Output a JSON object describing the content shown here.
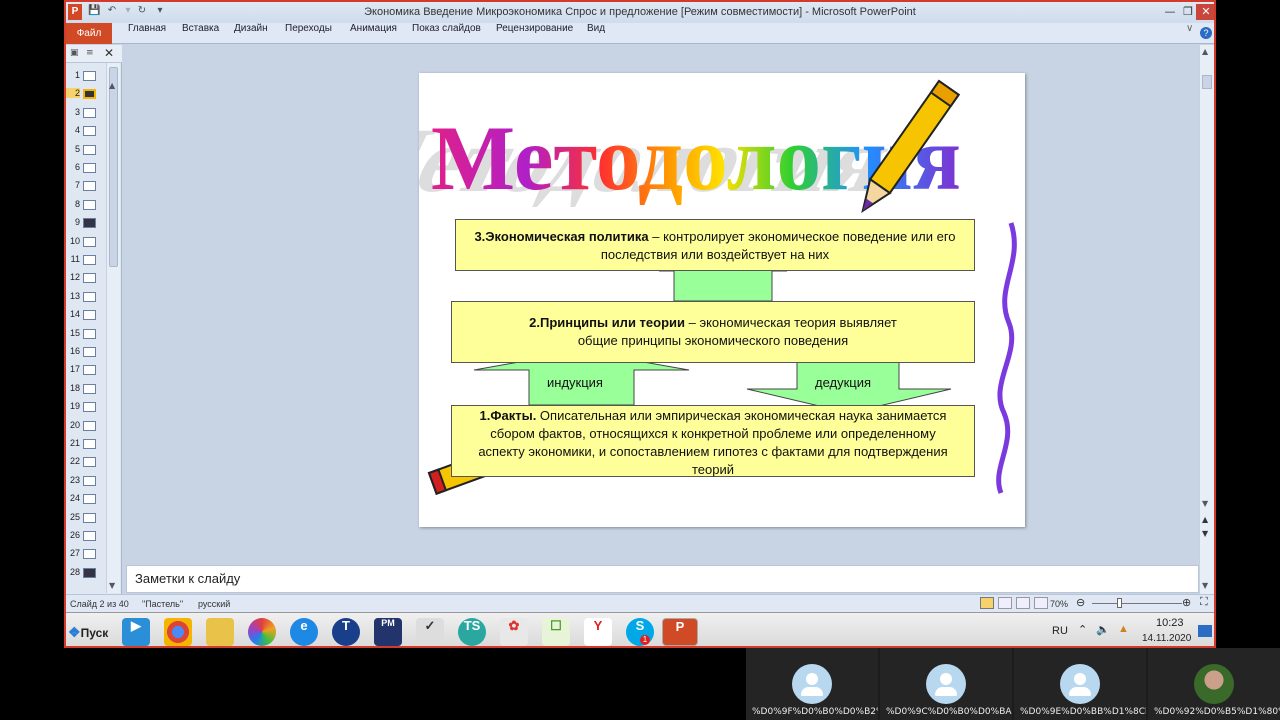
{
  "window": {
    "title": "Экономика Введение Микроэкономика Спрос и предложение [Режим совместимости]  -  Microsoft PowerPoint",
    "app_letter": "P"
  },
  "ribbon": {
    "file_tab": "Файл",
    "tabs": [
      "Главная",
      "Вставка",
      "Дизайн",
      "Переходы",
      "Анимация",
      "Показ слайдов",
      "Рецензирование",
      "Вид"
    ]
  },
  "thumbnails": {
    "numbers": [
      "1",
      "2",
      "3",
      "4",
      "5",
      "6",
      "7",
      "8",
      "9",
      "10",
      "11",
      "12",
      "13",
      "14",
      "15",
      "16",
      "17",
      "18",
      "19",
      "20",
      "21",
      "22",
      "23",
      "24",
      "25",
      "26",
      "27",
      "28"
    ],
    "selected": "2"
  },
  "slide": {
    "title": "Методология",
    "box3_bold": "3.Экономическая политика",
    "box3_text": " – контролирует экономическое поведение или его последствия или воздействует на них",
    "box2_bold": "2.Принципы или теории",
    "box2_text": " – экономическая теория выявляет общие принципы экономического поведения",
    "arrow_left": "индукция",
    "arrow_right": "дедукция",
    "box1_bold": "1.Факты.",
    "box1_text": " Описательная или эмпирическая экономическая наука занимается сбором фактов, относящихся к конкретной проблеме или определенному аспекту экономики, и сопоставлением гипотез с фактами для подтверждения теорий"
  },
  "notes": {
    "placeholder": "Заметки к слайду"
  },
  "status": {
    "slide_info": "Слайд 2 из 40",
    "theme": "\"Пастель\"",
    "language": "русский",
    "zoom": "70%"
  },
  "taskbar": {
    "start": "Пуск",
    "lang": "RU",
    "time": "10:23",
    "date": "14.11.2020",
    "badge": "1"
  },
  "participants": [
    {
      "name": "%D0%9F%D0%B0%D0%B2%D0%B..."
    },
    {
      "name": "%D0%9C%D0%B0%D0%BA%D1%81..."
    },
    {
      "name": "%D0%9E%D0%BB%D1%8Ck@"
    },
    {
      "name": "%D0%92%D0%B5%D1%80%D0%B0..."
    }
  ],
  "colors": {
    "accent": "#d14a26",
    "box_fill": "#ffff99",
    "arrow_fill": "#99ff99"
  }
}
